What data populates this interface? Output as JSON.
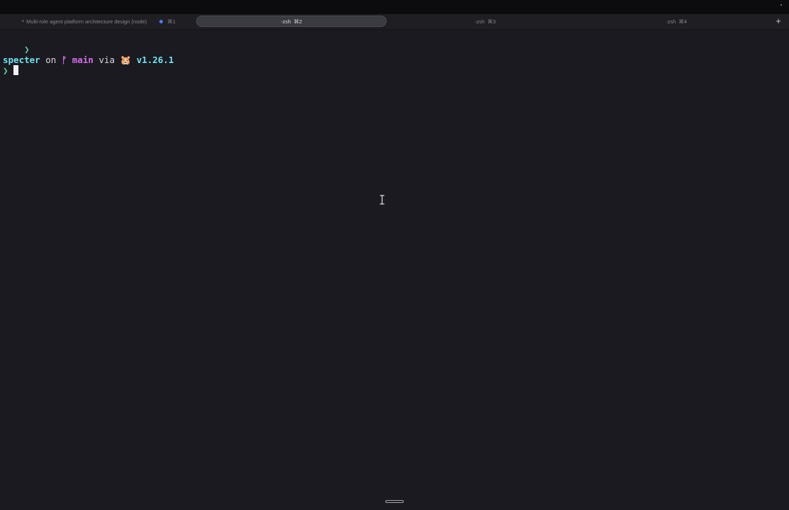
{
  "tabs": [
    {
      "prefix": "≡",
      "label": "Multi-role agent platform architecture design (node)",
      "shortcut": "⌘1",
      "has_dot": true
    },
    {
      "label": "-zsh",
      "shortcut": "⌘2",
      "active": true
    },
    {
      "label": "-zsh",
      "shortcut": "⌘3"
    },
    {
      "label": "-zsh",
      "shortcut": "⌘4"
    }
  ],
  "new_tab_label": "+",
  "terminal": {
    "prompt_symbol": "❯",
    "directory": "specter",
    "on_text": "on",
    "branch_icon": "ᚠ",
    "branch": "main",
    "via_text": "via",
    "runtime_icon": "🐹",
    "version": "v1.26.1"
  },
  "colors": {
    "background": "#1a1a20",
    "prompt": "#5ad1a0",
    "directory": "#6fe2f2",
    "branch": "#d36ee8",
    "tab_dot": "#4d7cf0"
  },
  "icons": {
    "cursor": "text-cursor-icon",
    "ibeam": "ibeam-pointer-icon",
    "new_tab": "plus-icon"
  }
}
